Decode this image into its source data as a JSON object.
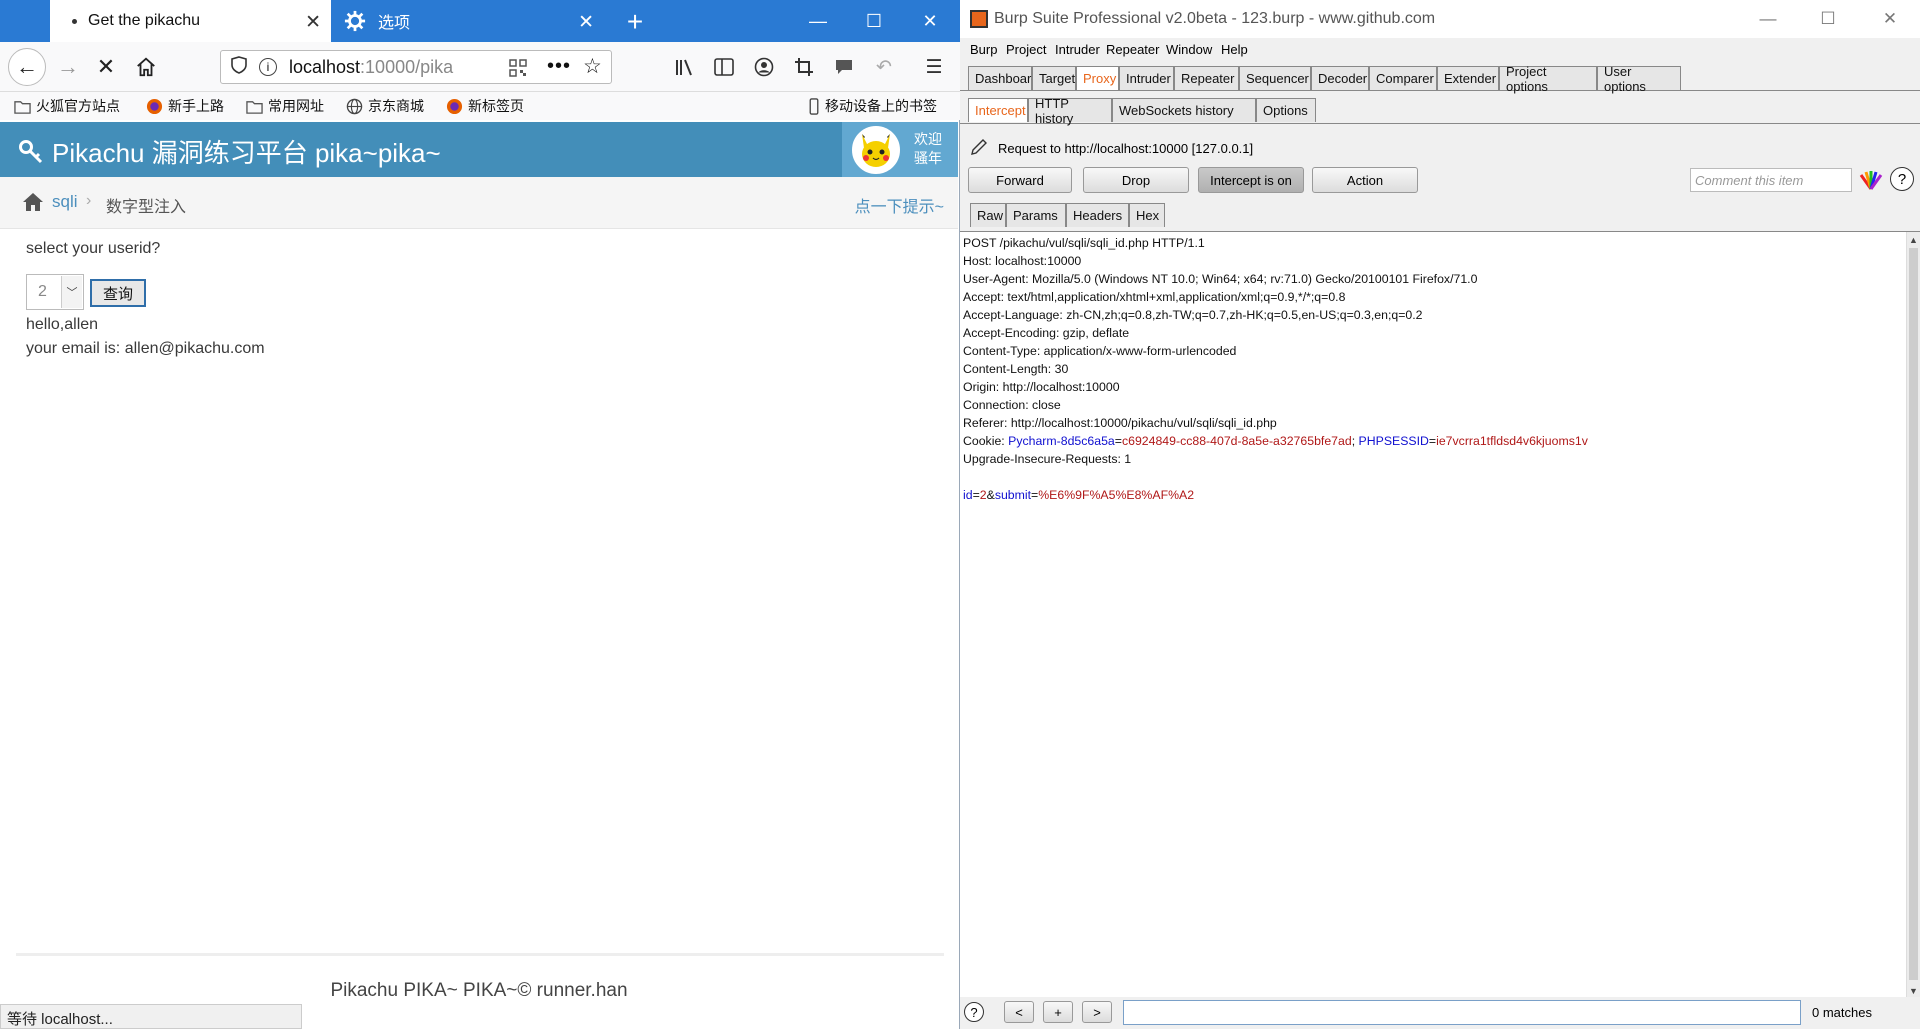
{
  "firefox": {
    "tabs": [
      {
        "label": "Get the pikachu",
        "active": true
      },
      {
        "label": "选项",
        "active": false
      }
    ],
    "url": {
      "host": "localhost",
      "rest": ":10000/pika"
    },
    "bookmarks": [
      {
        "label": "火狐官方站点",
        "icon": "folder-icon"
      },
      {
        "label": "新手上路",
        "icon": "firefox-icon"
      },
      {
        "label": "常用网址",
        "icon": "folder-icon"
      },
      {
        "label": "京东商城",
        "icon": "globe-icon"
      },
      {
        "label": "新标签页",
        "icon": "firefox-icon"
      }
    ],
    "mobile_bookmarks": "移动设备上的书签",
    "status": "等待 localhost..."
  },
  "pikachu": {
    "site_title": "Pikachu 漏洞练习平台 pika~pika~",
    "welcome": [
      "欢迎",
      "骚年"
    ],
    "breadcrumb": {
      "section": "sqli",
      "page": "数字型注入",
      "hint": "点一下提示~"
    },
    "question": "select your userid?",
    "select_value": "2",
    "submit_label": "查询",
    "result_line1": "hello,allen",
    "result_line2": "your email is: allen@pikachu.com",
    "footer": "Pikachu PIKA~ PIKA~© runner.han"
  },
  "burp": {
    "title": "Burp Suite Professional v2.0beta - 123.burp - www.github.com",
    "menu": [
      "Burp",
      "Project",
      "Intruder",
      "Repeater",
      "Window",
      "Help"
    ],
    "main_tabs": [
      "Dashboard",
      "Target",
      "Proxy",
      "Intruder",
      "Repeater",
      "Sequencer",
      "Decoder",
      "Comparer",
      "Extender",
      "Project options",
      "User options"
    ],
    "active_main_tab": "Proxy",
    "proxy_tabs": [
      "Intercept",
      "HTTP history",
      "WebSockets history",
      "Options"
    ],
    "active_proxy_tab": "Intercept",
    "request_to": "Request to http://localhost:10000  [127.0.0.1]",
    "buttons": {
      "forward": "Forward",
      "drop": "Drop",
      "intercept": "Intercept is on",
      "action": "Action"
    },
    "comment_placeholder": "Comment this item",
    "view_tabs": [
      "Raw",
      "Params",
      "Headers",
      "Hex"
    ],
    "active_view_tab": "Raw",
    "request_lines": [
      "POST /pikachu/vul/sqli/sqli_id.php HTTP/1.1",
      "Host: localhost:10000",
      "User-Agent: Mozilla/5.0 (Windows NT 10.0; Win64; x64; rv:71.0) Gecko/20100101 Firefox/71.0",
      "Accept: text/html,application/xhtml+xml,application/xml;q=0.9,*/*;q=0.8",
      "Accept-Language: zh-CN,zh;q=0.8,zh-TW;q=0.7,zh-HK;q=0.5,en-US;q=0.3,en;q=0.2",
      "Accept-Encoding: gzip, deflate",
      "Content-Type: application/x-www-form-urlencoded",
      "Content-Length: 30",
      "Origin: http://localhost:10000",
      "Connection: close",
      "Referer: http://localhost:10000/pikachu/vul/sqli/sqli_id.php"
    ],
    "cookie": {
      "label": "Cookie: ",
      "name1": "Pycharm-8d5c6a5a",
      "value1": "c6924849-cc88-407d-8a5e-a32765bfe7ad",
      "sep": "; ",
      "name2": "PHPSESSID",
      "value2": "ie7vcrra1tfldsd4v6kjuoms1v"
    },
    "upgrade_line": "Upgrade-Insecure-Requests: 1",
    "body": {
      "p1": "id",
      "v1": "2",
      "p2": "submit",
      "v2": "%E6%9F%A5%E8%AF%A2"
    },
    "nav_buttons": [
      "<",
      "+",
      ">"
    ],
    "matches": "0 matches",
    "colors": {
      "accent": "#e8661c",
      "param_name": "#1010d0",
      "param_value": "#b01818"
    }
  }
}
